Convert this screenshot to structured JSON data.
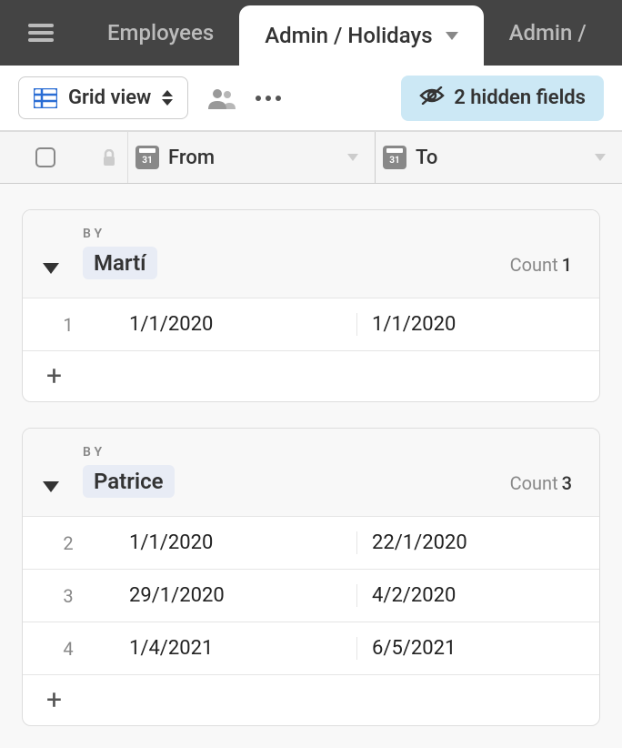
{
  "tabs": [
    {
      "label": "Employees",
      "active": false
    },
    {
      "label": "Admin / Holidays",
      "active": true
    },
    {
      "label": "Admin /",
      "active": false
    }
  ],
  "toolbar": {
    "view_label": "Grid view",
    "hidden_fields_label": "2 hidden fields"
  },
  "columns": {
    "from": "From",
    "to": "To"
  },
  "groups": [
    {
      "by_label": "BY",
      "name": "Martí",
      "count_label": "Count",
      "count": "1",
      "rows": [
        {
          "num": "1",
          "from": "1/1/2020",
          "to": "1/1/2020"
        }
      ]
    },
    {
      "by_label": "BY",
      "name": "Patrice",
      "count_label": "Count",
      "count": "3",
      "rows": [
        {
          "num": "2",
          "from": "1/1/2020",
          "to": "22/1/2020"
        },
        {
          "num": "3",
          "from": "29/1/2020",
          "to": "4/2/2020"
        },
        {
          "num": "4",
          "from": "1/4/2021",
          "to": "6/5/2021"
        }
      ]
    }
  ]
}
